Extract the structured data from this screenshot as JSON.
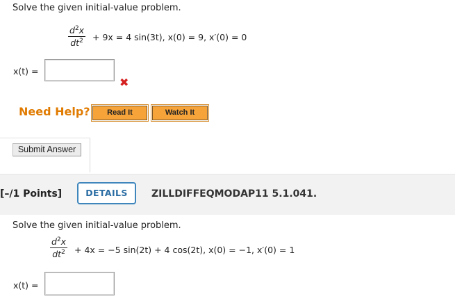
{
  "q1": {
    "prompt": "Solve the given initial-value problem.",
    "numerator": "d",
    "num_sup": "2",
    "num_var": "x",
    "denominator": "dt",
    "den_sup": "2",
    "equation_rest": "+ 9x = 4 sin(3t), x(0) = 9,  x′(0) = 0",
    "answer_label": "x(t) =",
    "answer_value": "",
    "status_icon": "wrong-x-icon",
    "status_mark": "✖"
  },
  "help": {
    "label": "Need Help?",
    "read_button": "Read It",
    "watch_button": "Watch It"
  },
  "submit": {
    "label": "Submit Answer"
  },
  "q2": {
    "points": "[–/1 Points]",
    "details_button": "DETAILS",
    "problem_code": "ZILLDIFFEQMODAP11 5.1.041.",
    "prompt": "Solve the given initial-value problem.",
    "numerator": "d",
    "num_sup": "2",
    "num_var": "x",
    "denominator": "dt",
    "den_sup": "2",
    "equation_rest": "+ 4x = −5 sin(2t) + 4 cos(2t), x(0) = −1,  x′(0) = 1",
    "answer_label": "x(t) =",
    "answer_value": ""
  },
  "colors": {
    "help_text": "#e07b00",
    "help_button": "#f6a33a",
    "details_border": "#3f86bd",
    "wrong_mark": "#d52020",
    "points_bar": "#f2f2f2"
  }
}
